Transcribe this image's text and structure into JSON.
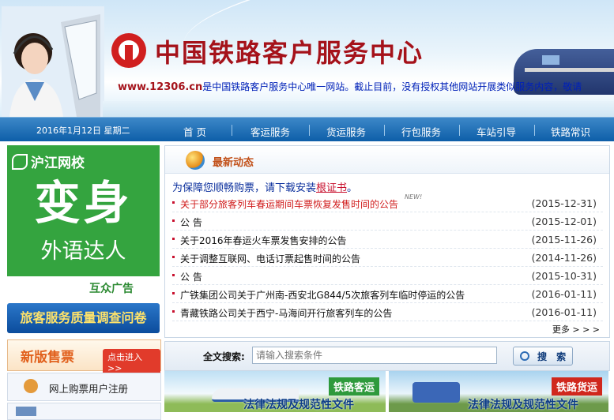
{
  "header": {
    "site_title": "中国铁路客户服务中心",
    "marquee_url": "www.12306.cn",
    "marquee_text": "是中国铁路客户服务中心唯一网站。截止目前，没有授权其他网站开展类似服务内容，敬请"
  },
  "nav": {
    "date": "2016年1月12日 星期二",
    "items": [
      "首 页",
      "客运服务",
      "货运服务",
      "行包服务",
      "车站引导",
      "铁路常识"
    ]
  },
  "left": {
    "ad": {
      "brand": "沪江网校",
      "big": "变身",
      "sub": "外语达人",
      "footer": "互众广告"
    },
    "survey": "旅客服务质量调查问卷",
    "new_ticket": {
      "title": "新版售票",
      "enter": "点击进入>>"
    },
    "register": "网上购票用户注册"
  },
  "news": {
    "title": "最新动态",
    "notice_prefix": "为保障您顺畅购票，请下载安装",
    "notice_link": "根证书",
    "notice_suffix": "。",
    "new_badge": "NEW!",
    "items": [
      {
        "title": "关于部分旅客列车春运期间车票恢复发售时间的公告",
        "date": "(2015-12-31)"
      },
      {
        "title": "公 告",
        "date": "(2015-12-01)"
      },
      {
        "title": "关于2016年春运火车票发售安排的公告",
        "date": "(2015-11-26)"
      },
      {
        "title": "关于调整互联网、电话订票起售时间的公告",
        "date": "(2014-11-26)"
      },
      {
        "title": "公 告",
        "date": "(2015-10-31)"
      },
      {
        "title": "广铁集团公司关于广州南-西安北G844/5次旅客列车临时停运的公告",
        "date": "(2016-01-11)"
      },
      {
        "title": "青藏铁路公司关于西宁-马海间开行旅客列车的公告",
        "date": "(2016-01-11)"
      }
    ],
    "more": "更多 > > >"
  },
  "search": {
    "label": "全文搜索:",
    "placeholder": "请输入搜索条件",
    "button": "搜 索"
  },
  "banners": {
    "passenger": {
      "tag": "铁路客运",
      "caption": "法律法规及规范性文件"
    },
    "freight": {
      "tag": "铁路货运",
      "caption": "法律法规及规范性文件"
    }
  }
}
